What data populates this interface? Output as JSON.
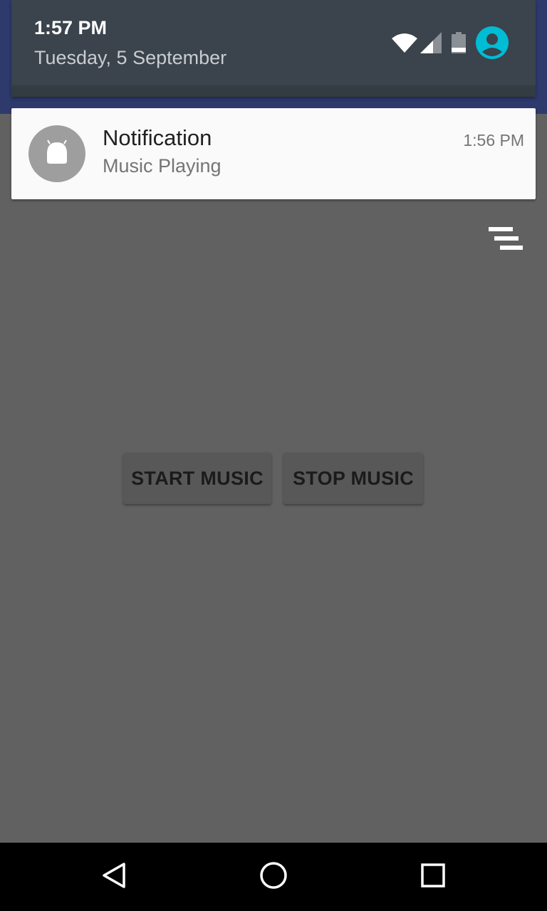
{
  "status_header": {
    "time": "1:57 PM",
    "date": "Tuesday, 5 September",
    "icons": [
      "wifi-icon",
      "cell-signal-icon",
      "battery-icon",
      "user-avatar-icon"
    ],
    "avatar_color": "#00bcd4"
  },
  "notification": {
    "title": "Notification",
    "text": "Music Playing",
    "time": "1:56 PM",
    "icon": "android-icon"
  },
  "clear_all": {
    "icon": "clear-all-icon"
  },
  "app": {
    "start_label": "START MUSIC",
    "stop_label": "STOP MUSIC"
  },
  "nav_bar": {
    "icons": [
      "back-icon",
      "home-icon",
      "recents-icon"
    ]
  }
}
